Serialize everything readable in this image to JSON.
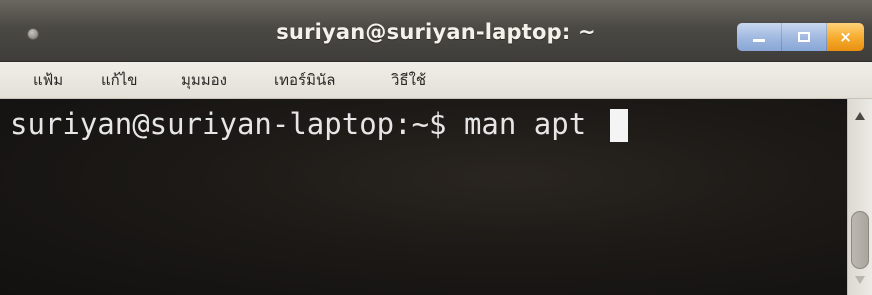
{
  "window": {
    "title": "suriyan@suriyan-laptop: ~",
    "controls": {
      "minimize_label": "–",
      "maximize_icon": "maximize-icon",
      "close_label": "×"
    }
  },
  "menubar": {
    "items": [
      {
        "label": "แฟ้ม"
      },
      {
        "label": "แก้ไข"
      },
      {
        "label": "มุมมอง"
      },
      {
        "label": "เทอร์มินัล"
      },
      {
        "label": "วิธีใช้"
      }
    ]
  },
  "terminal": {
    "prompt": "suriyan@suriyan-laptop:~$ ",
    "command": "man apt"
  },
  "scrollbar": {
    "up_icon": "scroll-up-arrow-icon",
    "down_icon": "scroll-down-arrow-icon"
  }
}
